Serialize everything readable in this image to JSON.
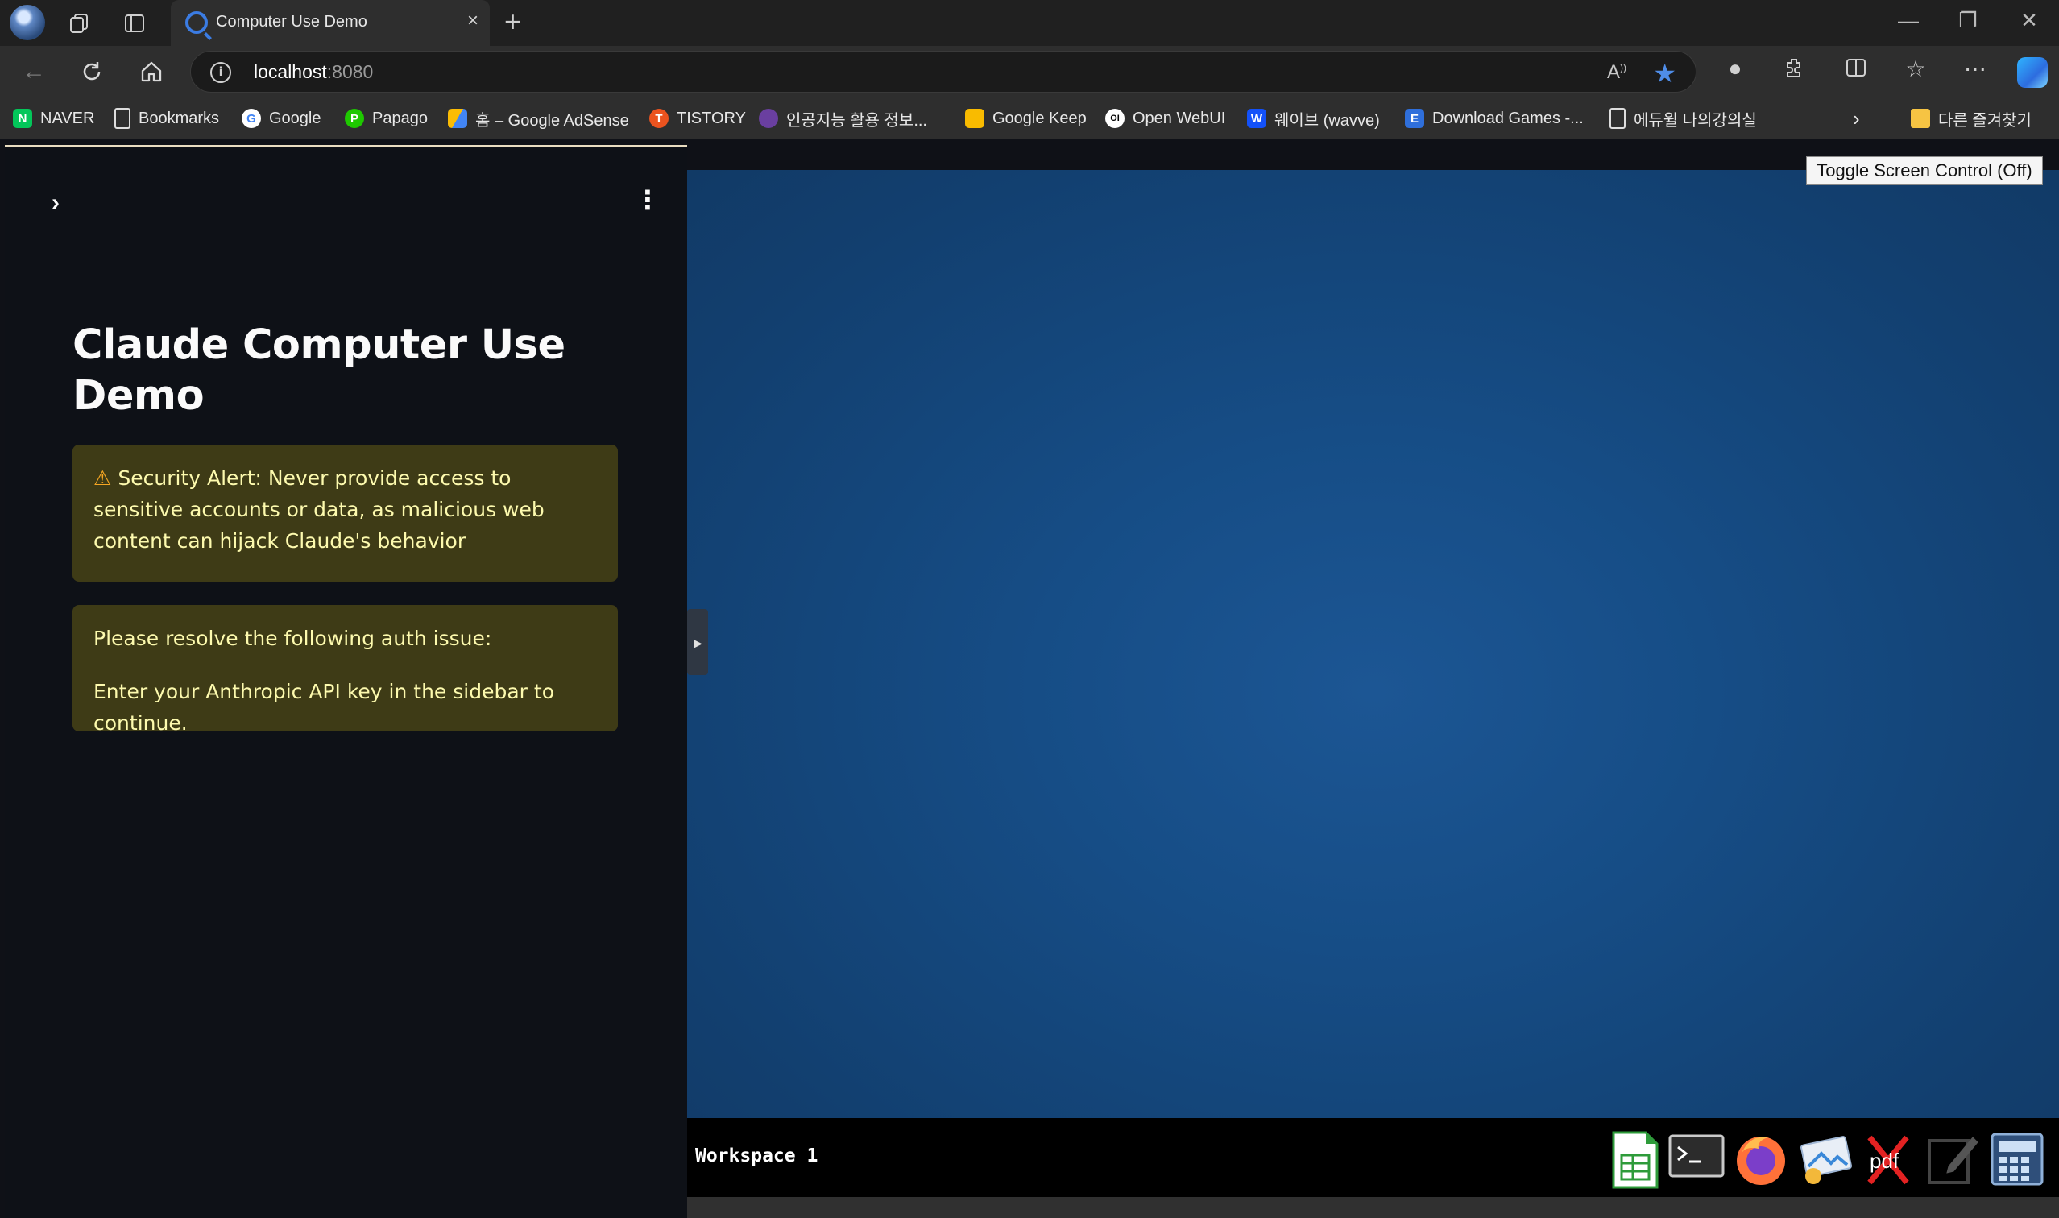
{
  "browser": {
    "tab_title": "Computer Use Demo",
    "tab_close": "×",
    "new_tab": "+",
    "url_host": "localhost",
    "url_port": ":8080",
    "window_controls": {
      "minimize": "—",
      "restore": "❐",
      "close": "✕"
    }
  },
  "bookmarks": [
    {
      "label": "NAVER",
      "icon": "naver-icon",
      "color": "#03c75a",
      "glyph": "N"
    },
    {
      "label": "Bookmarks",
      "icon": "document-icon",
      "color": "",
      "glyph": ""
    },
    {
      "label": "Google",
      "icon": "google-icon",
      "color": "#ffffff",
      "glyph": "G"
    },
    {
      "label": "Papago",
      "icon": "papago-icon",
      "color": "#1ec800",
      "glyph": "P"
    },
    {
      "label": "홈 – Google AdSense",
      "icon": "adsense-icon",
      "color": "#fbbc04",
      "glyph": ""
    },
    {
      "label": "TISTORY",
      "icon": "tistory-icon",
      "color": "#eb531f",
      "glyph": "T"
    },
    {
      "label": "인공지능 활용 정보...",
      "icon": "brain-icon",
      "color": "#6a3fa0",
      "glyph": ""
    },
    {
      "label": "Google Keep",
      "icon": "keep-icon",
      "color": "#f9bb00",
      "glyph": ""
    },
    {
      "label": "Open WebUI",
      "icon": "openwebui-icon",
      "color": "#ffffff",
      "glyph": "OI"
    },
    {
      "label": "웨이브 (wavve)",
      "icon": "wavve-icon",
      "color": "#1351f9",
      "glyph": "W"
    },
    {
      "label": "Download Games -...",
      "icon": "epic-icon",
      "color": "#2f6fdb",
      "glyph": "E"
    },
    {
      "label": "에듀윌 나의강의실",
      "icon": "document-icon",
      "color": "",
      "glyph": ""
    },
    {
      "label": "다른 즐겨찾기",
      "icon": "folder-icon",
      "color": "#f6c443",
      "glyph": ""
    }
  ],
  "sidebar": {
    "collapse_glyph": "›",
    "menu_glyph": "⋮",
    "title": "Claude Computer Use Demo",
    "security_alert": "Security Alert: Never provide access to sensitive accounts or data, as malicious web content can hijack Claude's behavior",
    "warning_glyph": "⚠",
    "auth_heading": "Please resolve the following auth issue:",
    "auth_message": "Enter your Anthropic API key in the sidebar to continue."
  },
  "vnc": {
    "toggle_label": "Toggle Screen Control (Off)",
    "workspace_label": "Workspace 1",
    "tray_apps": [
      "spreadsheet-icon",
      "terminal-icon",
      "firefox-icon",
      "image-viewer-icon",
      "pdf-icon",
      "text-editor-icon",
      "calculator-icon"
    ],
    "pdf_label": "pdf"
  },
  "colors": {
    "accent": "#3b7ce3",
    "alert_bg": "#3e3b16",
    "alert_text": "#fdfaae",
    "desktop_blue": "#164d86"
  }
}
